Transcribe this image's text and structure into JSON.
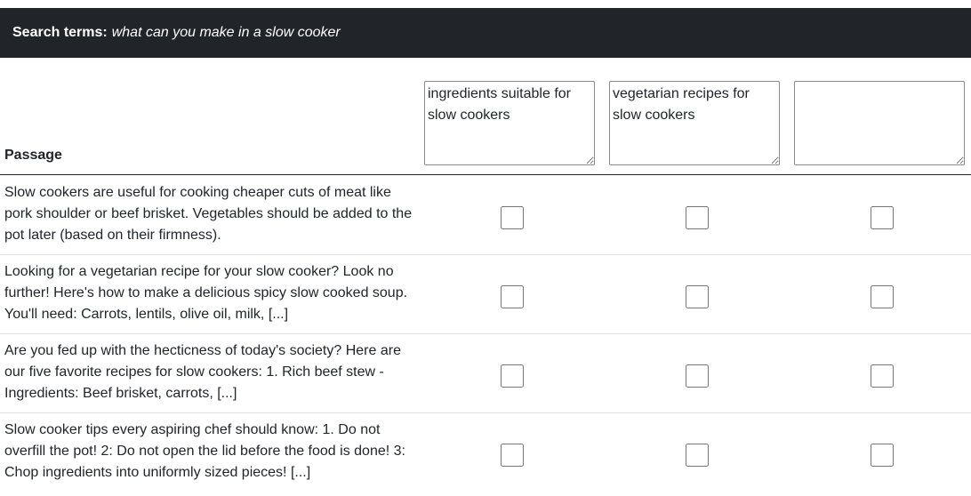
{
  "header": {
    "search_label": "Search terms:",
    "search_query": "what can you make in a slow cooker"
  },
  "table": {
    "passage_header": "Passage",
    "query_fields": [
      {
        "value": "ingredients suitable for slow cookers"
      },
      {
        "value": "vegetarian recipes for slow cookers"
      },
      {
        "value": ""
      }
    ],
    "rows": [
      {
        "passage": "Slow cookers are useful for cooking cheaper cuts of meat like pork shoulder or beef brisket. Vegetables should be added to the pot later (based on their firmness).",
        "checks": [
          false,
          false,
          false
        ]
      },
      {
        "passage": "Looking for a vegetarian recipe for your slow cooker? Look no further! Here's how to make a delicious spicy slow cooked soup. You'll need: Carrots, lentils, olive oil, milk, [...]",
        "checks": [
          false,
          false,
          false
        ]
      },
      {
        "passage": "Are you fed up with the hecticness of today's society? Here are our five favorite recipes for slow cookers: 1. Rich beef stew - Ingredients: Beef brisket, carrots, [...]",
        "checks": [
          false,
          false,
          false
        ]
      },
      {
        "passage": "Slow cooker tips every aspiring chef should know: 1. Do not overfill the pot! 2: Do not open the lid before the food is done! 3: Chop ingredients into uniformly sized pieces! [...]",
        "checks": [
          false,
          false,
          false
        ]
      }
    ]
  }
}
